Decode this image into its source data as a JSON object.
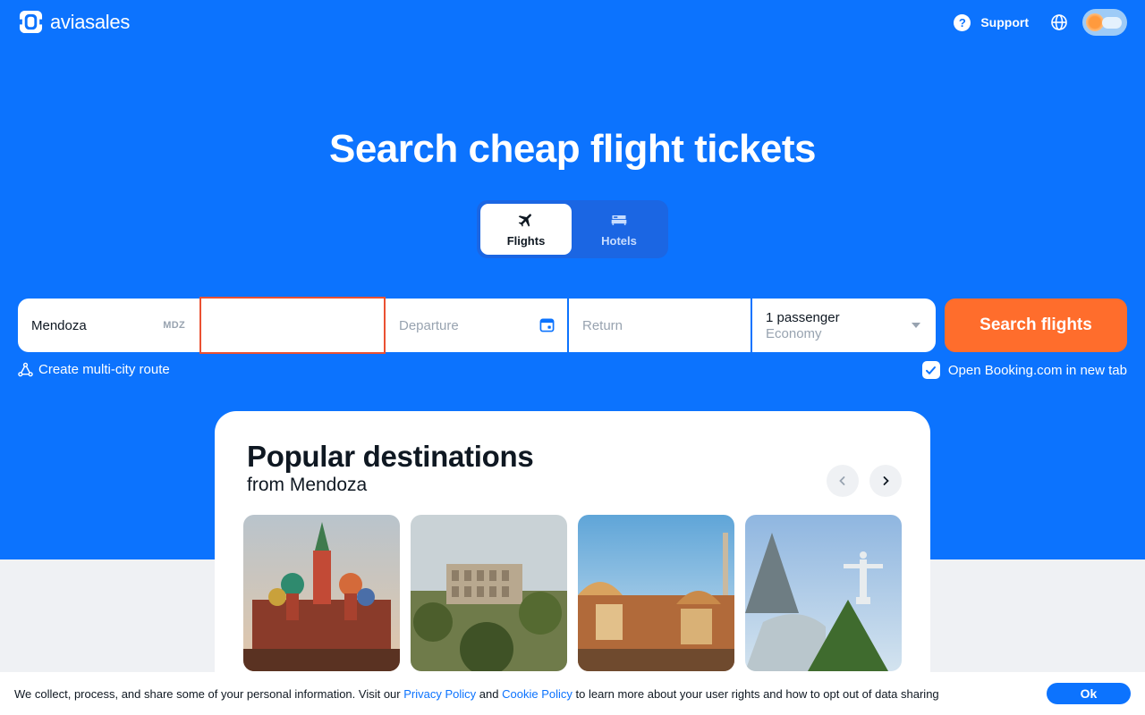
{
  "brand": {
    "name": "aviasales"
  },
  "header": {
    "support_label": "Support"
  },
  "hero": {
    "title": "Search cheap flight tickets"
  },
  "tabs": [
    {
      "label": "Flights",
      "icon": "plane-icon",
      "active": true
    },
    {
      "label": "Hotels",
      "icon": "bed-icon",
      "active": false
    }
  ],
  "search": {
    "origin_value": "Mendoza",
    "origin_code": "MDZ",
    "destination_value": "",
    "departure_placeholder": "Departure",
    "return_placeholder": "Return",
    "passengers": "1 passenger",
    "cabin_class": "Economy",
    "button_label": "Search flights"
  },
  "options": {
    "multi_city": "Create multi-city route",
    "booking_new_tab": "Open Booking.com in new tab",
    "booking_checked": true
  },
  "popular": {
    "title": "Popular destinations",
    "subtitle": "from Mendoza",
    "cards": [
      {
        "image": "saint-basils-cathedral"
      },
      {
        "image": "roman-colosseum"
      },
      {
        "image": "park-guell-barcelona"
      },
      {
        "image": "christ-the-redeemer-rio"
      }
    ]
  },
  "cookie": {
    "text_before": "We collect, process, and share some of your personal information. Visit our",
    "privacy_link": "Privacy Policy",
    "and": "and",
    "cookie_link": "Cookie Policy",
    "text_after": "to learn more about your user rights and how to opt out of data sharing",
    "ok_label": "Ok"
  },
  "colors": {
    "primary_blue": "#0c73fe",
    "cta_orange": "#ff6d2c",
    "focus_red": "#ea5132"
  }
}
